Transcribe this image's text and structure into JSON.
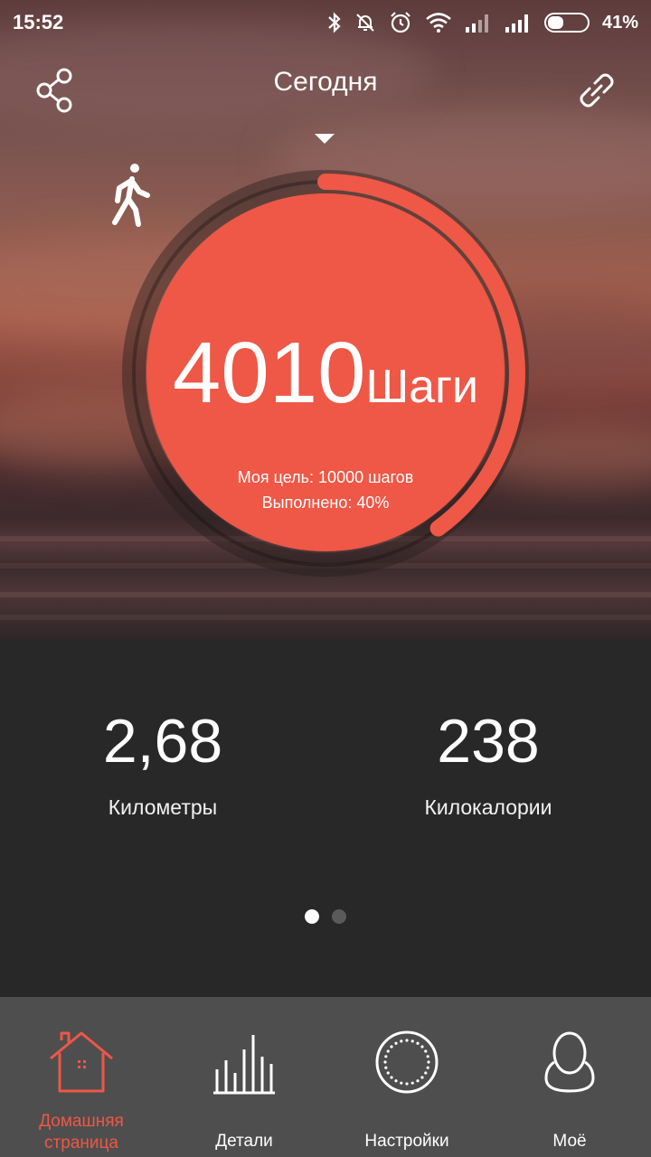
{
  "status_bar": {
    "time": "15:52",
    "battery_percent": "41%",
    "battery_level": 0.41,
    "icons": [
      "bluetooth-icon",
      "muted-bell-icon",
      "alarm-icon",
      "wifi-icon",
      "signal-icon",
      "signal-icon"
    ]
  },
  "header": {
    "title": "Сегодня",
    "left_icon": "share-icon",
    "right_icon": "link-icon"
  },
  "activity": {
    "icon": "walking-person-icon",
    "steps": "4010",
    "steps_unit": "Шаги",
    "goal": "Моя цель: 10000 шагов",
    "completed": "Выполнено: 40%",
    "progress": 0.4
  },
  "stats": {
    "distance": {
      "value": "2,68",
      "label": "Километры"
    },
    "calories": {
      "value": "238",
      "label": "Килокалории"
    }
  },
  "pager": {
    "pages": 2,
    "active": 0
  },
  "tabs": [
    {
      "label_line1": "Домашняя",
      "label_line2": "страница",
      "icon": "home-icon",
      "active": true
    },
    {
      "label_line1": "Детали",
      "icon": "bar-chart-icon",
      "active": false
    },
    {
      "label_line1": "Настройки",
      "icon": "settings-dial-icon",
      "active": false
    },
    {
      "label_line1": "Моё",
      "icon": "profile-icon",
      "active": false
    }
  ],
  "colors": {
    "accent": "#ef5746",
    "panel": "#282828",
    "tabbar": "#4e4e4e"
  }
}
